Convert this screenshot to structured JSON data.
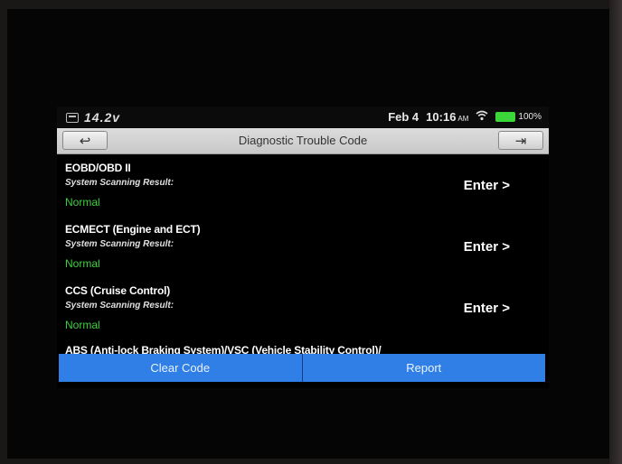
{
  "status_bar": {
    "voltage": "14.2v",
    "date": "Feb 4",
    "time": "10:16",
    "ampm": "AM",
    "battery": "100%",
    "icons": [
      "car-icon",
      "wifi-icon",
      "battery-icon"
    ]
  },
  "header": {
    "title": "Diagnostic Trouble Code",
    "back_glyph": "↩",
    "exit_glyph": "⇥"
  },
  "systems": [
    {
      "name": "EOBD/OBD II",
      "label": "System Scanning Result:",
      "result": "Normal",
      "enter": "Enter >"
    },
    {
      "name": "ECMECT (Engine and ECT)",
      "label": "System Scanning Result:",
      "result": "Normal",
      "enter": "Enter >"
    },
    {
      "name": "CCS (Cruise Control)",
      "label": "System Scanning Result:",
      "result": "Normal",
      "enter": "Enter >"
    },
    {
      "name": "ABS (Anti-lock Braking System)/VSC (Vehicle Stability Control)/"
    }
  ],
  "footer": {
    "clear_code": "Clear Code",
    "report": "Report"
  },
  "colors": {
    "result_normal": "#3bd13b",
    "footer_button": "#2f7fe6",
    "title_bar": "#d0d0d0"
  }
}
